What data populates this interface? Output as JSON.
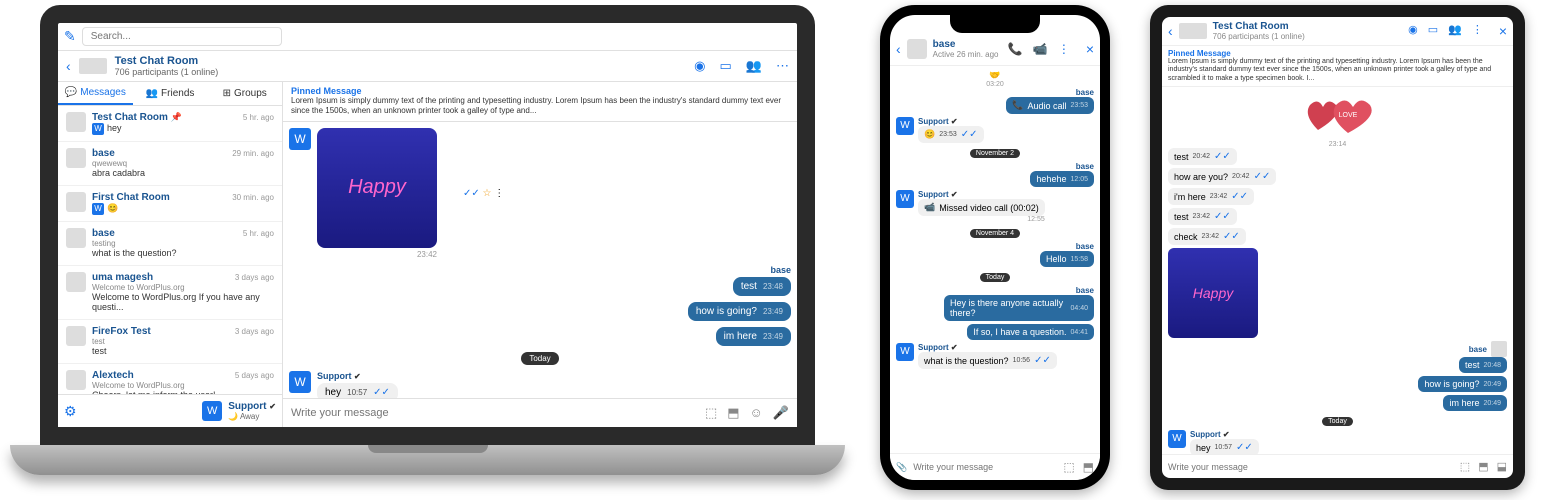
{
  "laptop": {
    "search_placeholder": "Search...",
    "header": {
      "title": "Test Chat Room",
      "subtitle": "706 participants (1 online)"
    },
    "tabs": {
      "messages": "Messages",
      "friends": "Friends",
      "groups": "Groups"
    },
    "conversations": [
      {
        "name": "Test Chat Room",
        "time": "5 hr. ago",
        "sub": "",
        "msg": "hey",
        "pinned": true,
        "wbadge": true
      },
      {
        "name": "base",
        "time": "29 min. ago",
        "sub": "qwewewq",
        "msg": "abra cadabra"
      },
      {
        "name": "First Chat Room",
        "time": "30 min. ago",
        "sub": "",
        "msg": "",
        "wbadge": true,
        "emoji": true
      },
      {
        "name": "base",
        "time": "5 hr. ago",
        "sub": "testing",
        "msg": "what is the question?"
      },
      {
        "name": "uma magesh",
        "time": "3 days ago",
        "sub": "Welcome to WordPlus.org",
        "msg": "Welcome to WordPlus.org If you have any questi..."
      },
      {
        "name": "FireFox Test",
        "time": "3 days ago",
        "sub": "test",
        "msg": "test"
      },
      {
        "name": "Alextech",
        "time": "5 days ago",
        "sub": "Welcome to WordPlus.org",
        "msg": "Cheers, let me inform the user!"
      }
    ],
    "footer": {
      "name": "Support",
      "status": "Away",
      "badge": "W"
    },
    "pinned": {
      "title": "Pinned Message",
      "text": "Lorem Ipsum is simply dummy text of the printing and typesetting industry. Lorem Ipsum has been the industry's standard dummy text ever since the 1500s, when an unknown printer took a galley of type and..."
    },
    "chat": {
      "image_caption": "Happy",
      "image_time": "23:42",
      "sender_base": "base",
      "msgs_right": [
        {
          "text": "test",
          "time": "23:48"
        },
        {
          "text": "how is going?",
          "time": "23:49"
        },
        {
          "text": "im here",
          "time": "23:49"
        }
      ],
      "date_today": "Today",
      "support": "Support",
      "hey": {
        "text": "hey",
        "time": "10:57"
      }
    },
    "composer_placeholder": "Write your message"
  },
  "phone": {
    "header": {
      "name": "base",
      "sub": "Active 26 min. ago"
    },
    "chat": {
      "hands_time": "03:20",
      "sender_base": "base",
      "audio_call": "Audio call",
      "audio_time": "23:53",
      "support": "Support",
      "emoji_time": "23:53",
      "date1": "November 2",
      "hehehe": "hehehe",
      "hehehe_time": "12:05",
      "missed": "Missed video call (00:02)",
      "missed_time": "12:55",
      "date2": "November 4",
      "hello": "Hello",
      "hello_time": "15:58",
      "date_today": "Today",
      "q1": "Hey is there anyone actually there?",
      "q1_time": "04:40",
      "q2": "If so, I have a question.",
      "q2_time": "04:41",
      "what": "what is the question?",
      "what_time": "10:56"
    },
    "composer_placeholder": "Write your message"
  },
  "tablet": {
    "header": {
      "title": "Test Chat Room",
      "sub": "706 participants (1 online)"
    },
    "pinned": {
      "title": "Pinned Message",
      "text": "Lorem Ipsum is simply dummy text of the printing and typesetting industry. Lorem Ipsum has been the industry's standard dummy text ever since the 1500s, when an unknown printer took a galley of type and scrambled it to make a type specimen book. I..."
    },
    "love_label": "LOVE",
    "time_2314": "23:14",
    "msgs_left": [
      {
        "text": "test",
        "time": "20:42"
      },
      {
        "text": "how are you?",
        "time": "20:42"
      },
      {
        "text": "i'm here",
        "time": "23:42"
      },
      {
        "text": "test",
        "time": "23:42"
      },
      {
        "text": "check",
        "time": "23:42"
      }
    ],
    "happy": "Happy",
    "sender_base": "base",
    "msgs_right": [
      {
        "text": "test",
        "time": "20:48"
      },
      {
        "text": "how is going?",
        "time": "20:49"
      },
      {
        "text": "im here",
        "time": "20:49"
      }
    ],
    "date_today": "Today",
    "support": "Support",
    "hey": {
      "text": "hey",
      "time": "10:57"
    },
    "composer_placeholder": "Write your message"
  }
}
